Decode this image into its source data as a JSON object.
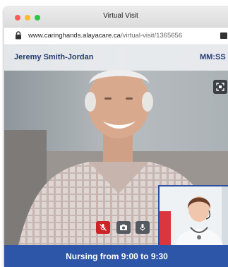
{
  "window": {
    "title": "Virtual Visit"
  },
  "browser": {
    "url_host": "www.caringhands.alayacare.ca",
    "url_path": "/virtual-visit/1365656"
  },
  "call": {
    "participant_name": "Jeremy Smith-Jordan",
    "timer": "MM:SS",
    "visit_label": "Nursing from 9:00 to 9:30"
  },
  "controls": {
    "mute_icon": "mic-muted-icon",
    "camera_icon": "camera-icon",
    "mic_icon": "microphone-icon",
    "expand_icon": "expand-icon"
  },
  "colors": {
    "brand_blue": "#2d55a8",
    "name_text": "#243a73",
    "mute_red": "#cc2228"
  }
}
